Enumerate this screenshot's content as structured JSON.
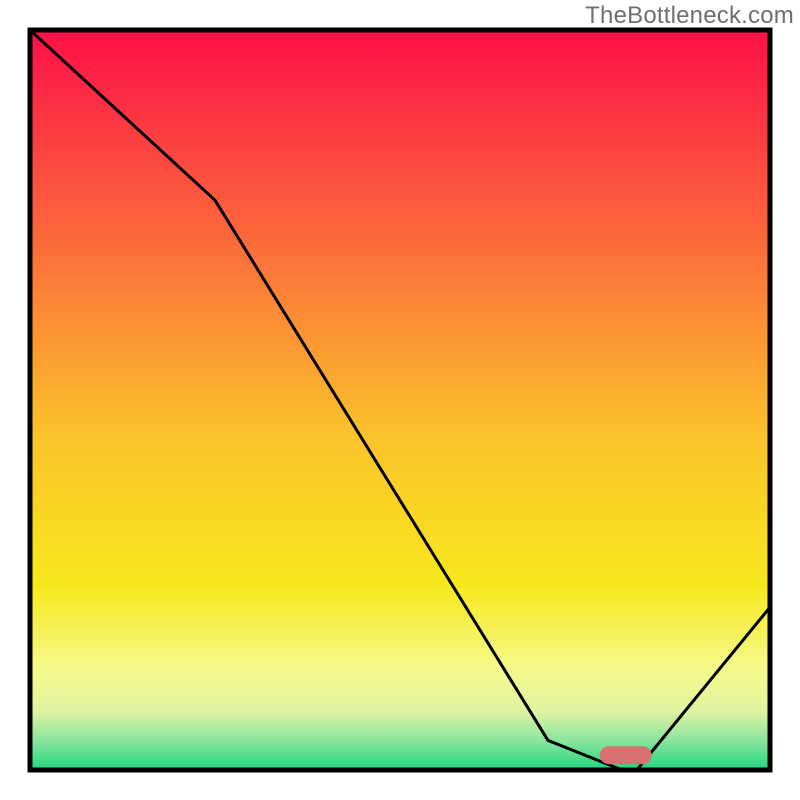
{
  "watermark": "TheBottleneck.com",
  "chart_data": {
    "type": "line",
    "title": "",
    "xlabel": "",
    "ylabel": "",
    "xlim": [
      0,
      100
    ],
    "ylim": [
      0,
      100
    ],
    "x": [
      0,
      25,
      70,
      80,
      82,
      100
    ],
    "values": [
      100,
      77,
      4,
      0,
      0,
      22
    ],
    "minimum_marker": {
      "x_start": 77,
      "x_end": 84,
      "y": 2,
      "color": "#d97170"
    },
    "gradient_stops": [
      {
        "offset": 0.0,
        "color": "#fe1048"
      },
      {
        "offset": 0.3,
        "color": "#fb6f3a"
      },
      {
        "offset": 0.55,
        "color": "#fbc32b"
      },
      {
        "offset": 0.75,
        "color": "#f7e81c"
      },
      {
        "offset": 0.86,
        "color": "#f6f988"
      },
      {
        "offset": 0.92,
        "color": "#e0f3a1"
      },
      {
        "offset": 0.96,
        "color": "#8be59e"
      },
      {
        "offset": 1.0,
        "color": "#1ed67e"
      }
    ]
  }
}
